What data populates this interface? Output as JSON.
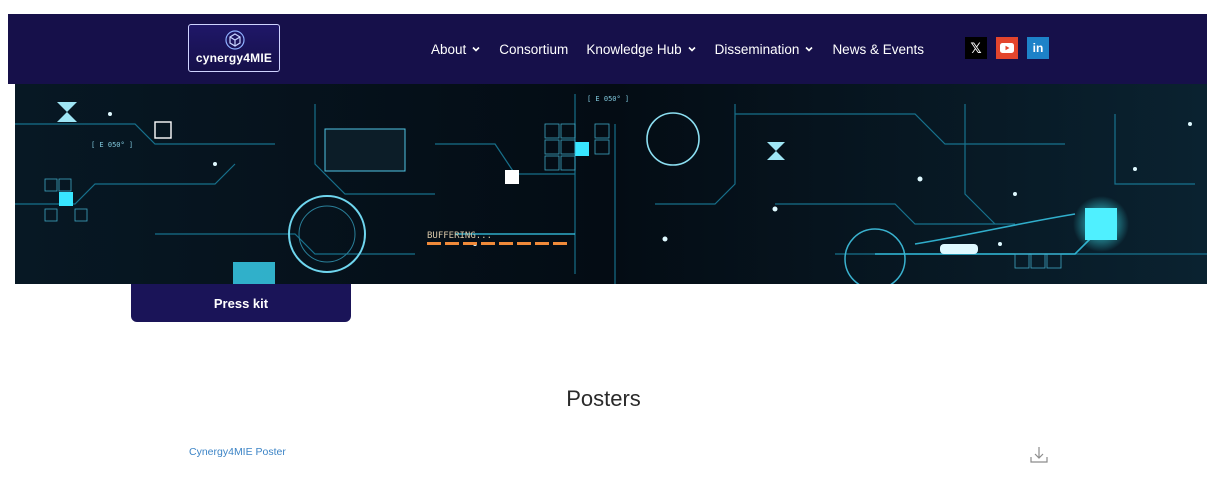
{
  "header": {
    "logo_text": "cynergy4MIE",
    "nav": [
      {
        "label": "About",
        "dropdown": true
      },
      {
        "label": "Consortium",
        "dropdown": false
      },
      {
        "label": "Knowledge Hub",
        "dropdown": true
      },
      {
        "label": "Dissemination",
        "dropdown": true
      },
      {
        "label": "News & Events",
        "dropdown": false
      }
    ],
    "social": {
      "x_glyph": "𝕏",
      "linkedin_glyph": "in",
      "icons": [
        "x-icon",
        "youtube-icon",
        "linkedin-icon"
      ]
    },
    "colors": {
      "nav_bg": "#16104a",
      "youtube": "#e3452d",
      "linkedin": "#1d82c8"
    }
  },
  "banner": {
    "overlay_text": "BUFFERING...",
    "chip_label_1": "[ E 050° ]",
    "chip_label_2": "[ E 050° ]"
  },
  "tab": {
    "label": "Press kit"
  },
  "posters": {
    "title": "Posters",
    "items": [
      {
        "name": "Cynergy4MIE Poster",
        "icon": "download-icon"
      }
    ]
  }
}
